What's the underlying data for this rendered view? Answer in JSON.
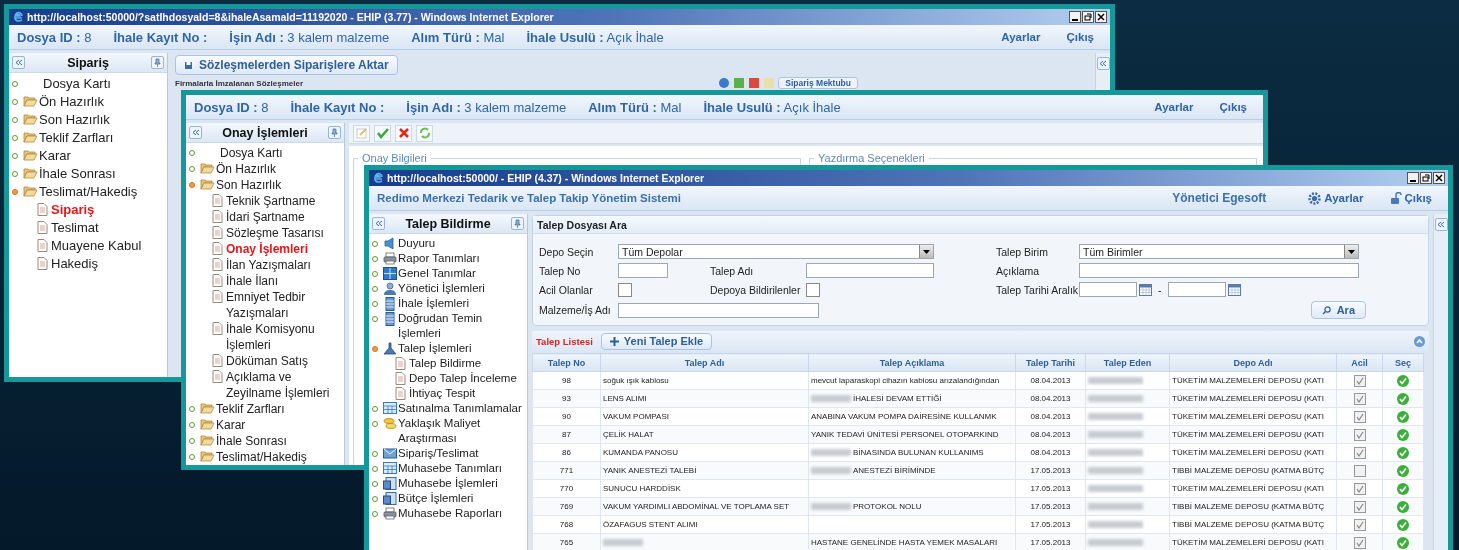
{
  "back_window": {
    "title": "http://localhost:50000/?satIhdosyaId=8&ihaleAsamaId=11192020 - EHIP (3.77) - Windows Internet Explorer",
    "header": {
      "fields": [
        {
          "label": "Dosya ID :",
          "value": "8"
        },
        {
          "label": "İhale Kayıt No :"
        },
        {
          "label": "İşin Adı :",
          "value": "3 kalem malzeme"
        },
        {
          "label": "Alım Türü :",
          "value": "Mal"
        },
        {
          "label": "İhale Usulü :",
          "value": "Açık İhale"
        }
      ],
      "links": [
        "Ayarlar",
        "Çıkış"
      ]
    },
    "sidebar": {
      "title": "Sipariş",
      "items": [
        {
          "label": "Dosya Kartı",
          "kind": "plain",
          "expanded": false
        },
        {
          "label": "Ön Hazırlık",
          "kind": "folder",
          "expanded": false
        },
        {
          "label": "Son Hazırlık",
          "kind": "folder",
          "expanded": false
        },
        {
          "label": "Teklif Zarfları",
          "kind": "folder",
          "expanded": false
        },
        {
          "label": "Karar",
          "kind": "folder",
          "expanded": false
        },
        {
          "label": "İhale Sonrası",
          "kind": "folder",
          "expanded": false
        },
        {
          "label": "Teslimat/Hakediş",
          "kind": "folder",
          "expanded": true,
          "children": [
            {
              "label": "Sipariş",
              "selected": true
            },
            {
              "label": "Teslimat",
              "selected": false
            },
            {
              "label": "Muayene Kabul",
              "selected": false
            },
            {
              "label": "Hakediş",
              "selected": false
            }
          ]
        }
      ]
    },
    "action_button": "Sözleşmelerden Siparişlere Aktar",
    "grid_title": "Firmalarla İmzalanan Sözleşmeler",
    "letter_button": "Sipariş Mektubu"
  },
  "middle_window": {
    "header": {
      "fields": [
        {
          "label": "Dosya ID :",
          "value": "8"
        },
        {
          "label": "İhale Kayıt No :"
        },
        {
          "label": "İşin Adı :",
          "value": "3 kalem malzeme"
        },
        {
          "label": "Alım Türü :",
          "value": "Mal"
        },
        {
          "label": "İhale Usulü :",
          "value": "Açık İhale"
        }
      ],
      "links": [
        "Ayarlar",
        "Çıkış"
      ]
    },
    "sidebar": {
      "title": "Onay İşlemleri",
      "items": [
        {
          "label": "Dosya Kartı",
          "kind": "plain",
          "expanded": false
        },
        {
          "label": "Ön Hazırlık",
          "kind": "folder",
          "expanded": false
        },
        {
          "label": "Son Hazırlık",
          "kind": "folder",
          "expanded": true,
          "children": [
            {
              "label": "Teknik Şartname",
              "selected": false
            },
            {
              "label": "İdari Şartname",
              "selected": false
            },
            {
              "label": "Sözleşme Tasarısı",
              "selected": false
            },
            {
              "label": "Onay İşlemleri",
              "selected": true
            },
            {
              "label": "İlan Yazışmaları",
              "selected": false
            },
            {
              "label": "İhale İlanı",
              "selected": false
            },
            {
              "label": "Emniyet Tedbir Yazışmaları",
              "selected": false
            },
            {
              "label": "İhale Komisyonu İşlemleri",
              "selected": false
            },
            {
              "label": "Döküman Satış",
              "selected": false
            },
            {
              "label": "Açıklama ve Zeyilname İşlemleri",
              "selected": false
            }
          ]
        },
        {
          "label": "Teklif Zarfları",
          "kind": "folder",
          "expanded": false
        },
        {
          "label": "Karar",
          "kind": "folder",
          "expanded": false
        },
        {
          "label": "İhale Sonrası",
          "kind": "folder",
          "expanded": false
        },
        {
          "label": "Teslimat/Hakediş",
          "kind": "folder",
          "expanded": false
        }
      ]
    },
    "fieldsets": [
      "Onay Bilgileri",
      "Yazdırma Seçenekleri"
    ]
  },
  "front_window": {
    "title": "http://localhost:50000/ - EHIP (4.37) - Windows Internet Explorer",
    "app_title": "Redimo Merkezi Tedarik ve Talep Takip Yönetim Sistemi",
    "user": "Yönetici Egesoft",
    "links": [
      "Ayarlar",
      "Çıkış"
    ],
    "sidebar": {
      "title": "Talep Bildirme",
      "items": [
        {
          "label": "Duyuru",
          "kind": "icon",
          "expanded": false
        },
        {
          "label": "Rapor Tanımları",
          "kind": "icon",
          "expanded": false
        },
        {
          "label": "Genel Tanımlar",
          "kind": "icon",
          "expanded": false
        },
        {
          "label": "Yönetici İşlemleri",
          "kind": "icon",
          "expanded": false
        },
        {
          "label": "İhale İşlemleri",
          "kind": "icon",
          "expanded": false
        },
        {
          "label": "Doğrudan Temin İşlemleri",
          "kind": "icon",
          "expanded": false
        },
        {
          "label": "Talep İşlemleri",
          "kind": "icon",
          "expanded": true,
          "children": [
            {
              "label": "Talep Bildirme",
              "selected": false
            },
            {
              "label": "Depo Talep İnceleme",
              "selected": false
            },
            {
              "label": "İhtiyaç Tespit",
              "selected": false
            }
          ]
        },
        {
          "label": "Satınalma Tanımlamalar",
          "kind": "icon",
          "expanded": false
        },
        {
          "label": "Yaklaşık Maliyet Araştırması",
          "kind": "icon",
          "expanded": false
        },
        {
          "label": "Sipariş/Teslimat",
          "kind": "icon",
          "expanded": false
        },
        {
          "label": "Muhasebe Tanımları",
          "kind": "icon",
          "expanded": false
        },
        {
          "label": "Muhasebe İşlemleri",
          "kind": "icon",
          "expanded": false
        },
        {
          "label": "Bütçe İşlemleri",
          "kind": "icon",
          "expanded": false
        },
        {
          "label": "Muhasebe Raporları",
          "kind": "icon",
          "expanded": false
        }
      ]
    },
    "search": {
      "title": "Talep Dosyası Ara",
      "depo_label": "Depo Seçin",
      "depo_value": "Tüm Depolar",
      "birim_label": "Talep Birim",
      "birim_value": "Tüm Birimler",
      "no_label": "Talep No",
      "ad_label": "Talep Adı",
      "aciklama_label": "Açıklama",
      "acil_label": "Acil Olanlar",
      "acil_checked": false,
      "depoya_label": "Depoya Bildirilenler",
      "depoya_checked": false,
      "tarih_label": "Talep Tarihi Aralık",
      "tarih_separator": "-",
      "malzeme_label": "Malzeme/İş Adı",
      "search_button": "Ara"
    },
    "list_title": "Talep Listesi",
    "add_button": "Yeni Talep Ekle",
    "table": {
      "columns": [
        "Talep No",
        "Talep Adı",
        "Talep Açıklama",
        "Talep Tarihi",
        "Talep Eden",
        "Depo Adı",
        "Acil",
        "Seç"
      ],
      "rows": [
        {
          "no": "98",
          "name": {
            "text": "soğuk ışık kablosu",
            "redacted": false
          },
          "desc": {
            "text": "mevcut laparaskopi cihazın kablosu arızalandığından",
            "redacted": false
          },
          "date": "08.04.2013",
          "requester_redacted": true,
          "depot": "TÜKETİM MALZEMELERİ DEPOSU (KATI",
          "urgent": true
        },
        {
          "no": "93",
          "name": {
            "text": "LENS ALIMI",
            "redacted": false
          },
          "desc": {
            "text": "İHALESİ DEVAM ETTİĞİ",
            "redacted": true
          },
          "date": "08.04.2013",
          "requester_redacted": true,
          "depot": "TÜKETİM MALZEMELERİ DEPOSU (KATI",
          "urgent": true
        },
        {
          "no": "90",
          "name": {
            "text": "VAKUM POMPASI",
            "redacted": false
          },
          "desc": {
            "text": "ANABINA VAKUM POMPA DAİRESİNE KULLANMK",
            "redacted": false
          },
          "date": "08.04.2013",
          "requester_redacted": true,
          "depot": "TÜKETİM MALZEMELERİ DEPOSU (KATI",
          "urgent": true
        },
        {
          "no": "87",
          "name": {
            "text": "ÇELİK HALAT",
            "redacted": false
          },
          "desc": {
            "text": "YANIK TEDAVİ ÜNİTESİ PERSONEL OTOPARKIND",
            "redacted": false
          },
          "date": "08.04.2013",
          "requester_redacted": true,
          "depot": "TÜKETİM MALZEMELERİ DEPOSU (KATI",
          "urgent": true
        },
        {
          "no": "86",
          "name": {
            "text": "KUMANDA PANOSU",
            "redacted": false
          },
          "desc": {
            "text": "BİNASINDA BULUNAN KULLANIMS",
            "redacted": true
          },
          "date": "08.04.2013",
          "requester_redacted": true,
          "depot": "TÜKETİM MALZEMELERİ DEPOSU (KATI",
          "urgent": true
        },
        {
          "no": "771",
          "name": {
            "text": "YANIK ANESTEZİ TALEBİ",
            "redacted": false
          },
          "desc": {
            "text": "ANESTEZİ BİRİMİNDE",
            "redacted": true
          },
          "date": "17.05.2013",
          "requester_redacted": true,
          "depot": "TIBBİ MALZEME DEPOSU (KATMA BÜTÇ",
          "urgent": false
        },
        {
          "no": "770",
          "name": {
            "text": "SUNUCU HARDDİSK",
            "redacted": false
          },
          "desc": {
            "redacted": false
          },
          "date": "17.05.2013",
          "requester_redacted": true,
          "depot": "TÜKETİM MALZEMELERİ DEPOSU (KATI",
          "urgent": true
        },
        {
          "no": "769",
          "name": {
            "text": "VAKUM YARDIMLI ABDOMİNAL VE TOPLAMA SET",
            "redacted": false
          },
          "desc": {
            "text": "PROTOKOL NOLU",
            "redacted": true
          },
          "date": "17.05.2013",
          "requester_redacted": true,
          "depot": "TIBBİ MALZEME DEPOSU (KATMA BÜTÇ",
          "urgent": true
        },
        {
          "no": "768",
          "name": {
            "text": "ÖZAFAGUS STENT ALIMI",
            "redacted": false
          },
          "desc": {
            "redacted": false
          },
          "date": "17.05.2013",
          "requester_redacted": true,
          "depot": "TIBBİ MALZEME DEPOSU (KATMA BÜTÇ",
          "urgent": true
        },
        {
          "no": "765",
          "name": {
            "redacted": true
          },
          "desc": {
            "text": "HASTANE GENELİNDE HASTA YEMEK MASALARI",
            "redacted": false
          },
          "date": "17.05.2013",
          "requester_redacted": true,
          "depot": "TÜKETİM MALZEMELERİ DEPOSU (KATI",
          "urgent": true
        }
      ]
    }
  }
}
